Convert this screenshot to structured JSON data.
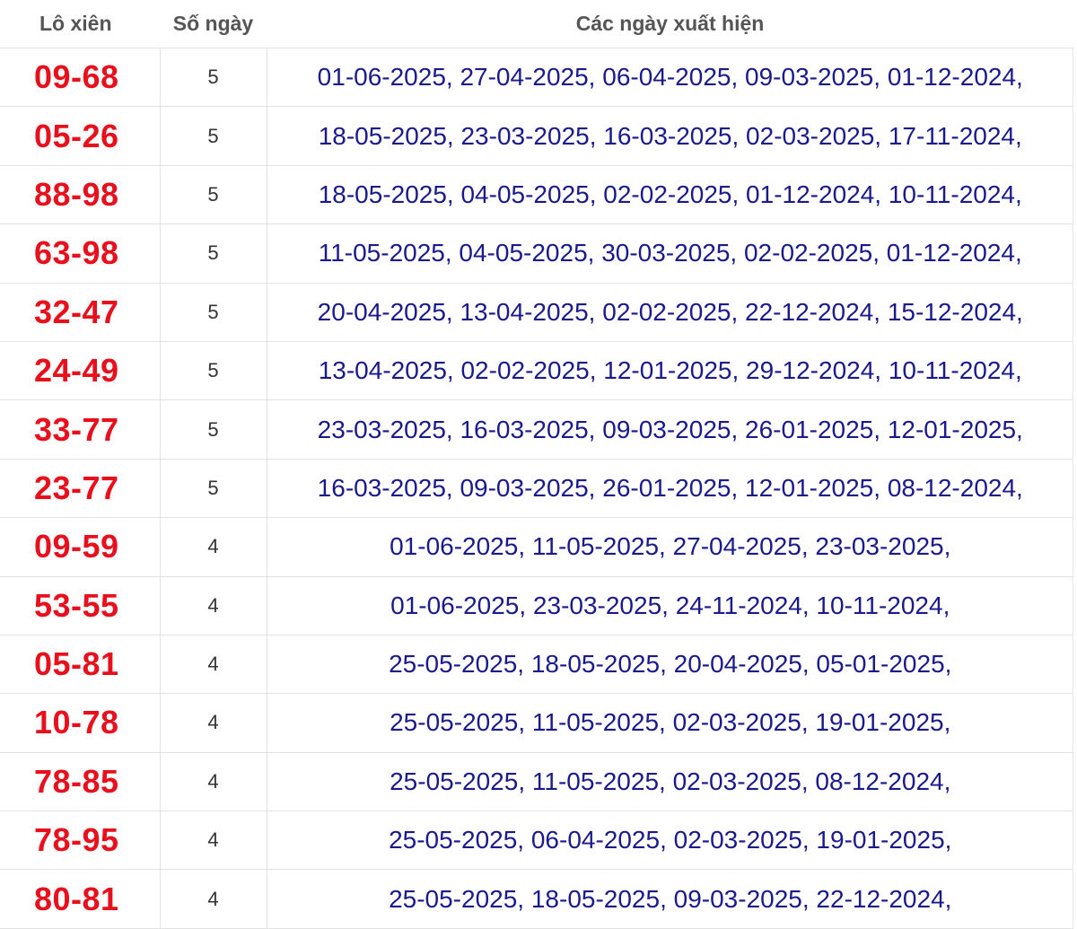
{
  "table": {
    "headers": [
      "Lô xiên",
      "Số ngày",
      "Các ngày xuất hiện"
    ],
    "rows": [
      {
        "pair": "09-68",
        "count": "5",
        "dates": "01-06-2025, 27-04-2025, 06-04-2025, 09-03-2025, 01-12-2024,"
      },
      {
        "pair": "05-26",
        "count": "5",
        "dates": "18-05-2025, 23-03-2025, 16-03-2025, 02-03-2025, 17-11-2024,"
      },
      {
        "pair": "88-98",
        "count": "5",
        "dates": "18-05-2025, 04-05-2025, 02-02-2025, 01-12-2024, 10-11-2024,"
      },
      {
        "pair": "63-98",
        "count": "5",
        "dates": "11-05-2025, 04-05-2025, 30-03-2025, 02-02-2025, 01-12-2024,"
      },
      {
        "pair": "32-47",
        "count": "5",
        "dates": "20-04-2025, 13-04-2025, 02-02-2025, 22-12-2024, 15-12-2024,"
      },
      {
        "pair": "24-49",
        "count": "5",
        "dates": "13-04-2025, 02-02-2025, 12-01-2025, 29-12-2024, 10-11-2024,"
      },
      {
        "pair": "33-77",
        "count": "5",
        "dates": "23-03-2025, 16-03-2025, 09-03-2025, 26-01-2025, 12-01-2025,"
      },
      {
        "pair": "23-77",
        "count": "5",
        "dates": "16-03-2025, 09-03-2025, 26-01-2025, 12-01-2025, 08-12-2024,"
      },
      {
        "pair": "09-59",
        "count": "4",
        "dates": "01-06-2025, 11-05-2025, 27-04-2025, 23-03-2025,"
      },
      {
        "pair": "53-55",
        "count": "4",
        "dates": "01-06-2025, 23-03-2025, 24-11-2024, 10-11-2024,"
      },
      {
        "pair": "05-81",
        "count": "4",
        "dates": "25-05-2025, 18-05-2025, 20-04-2025, 05-01-2025,"
      },
      {
        "pair": "10-78",
        "count": "4",
        "dates": "25-05-2025, 11-05-2025, 02-03-2025, 19-01-2025,"
      },
      {
        "pair": "78-85",
        "count": "4",
        "dates": "25-05-2025, 11-05-2025, 02-03-2025, 08-12-2024,"
      },
      {
        "pair": "78-95",
        "count": "4",
        "dates": "25-05-2025, 06-04-2025, 02-03-2025, 19-01-2025,"
      },
      {
        "pair": "80-81",
        "count": "4",
        "dates": "25-05-2025, 18-05-2025, 09-03-2025, 22-12-2024,"
      }
    ]
  },
  "colors": {
    "pair": "#e8101c",
    "dates": "#1a1a8c",
    "header": "#555555",
    "count": "#333333",
    "border": "#e2e2e2"
  }
}
